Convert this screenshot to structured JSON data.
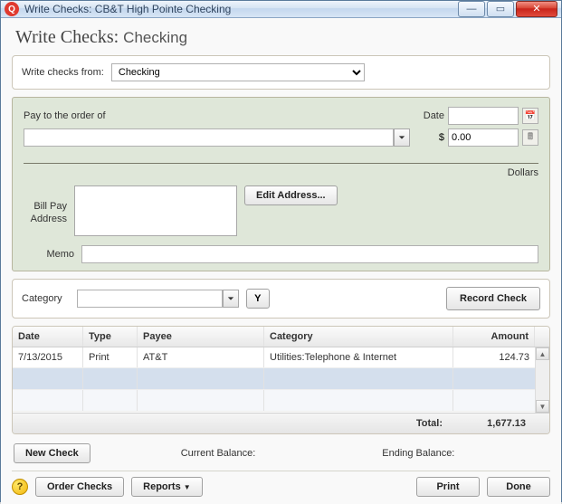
{
  "window": {
    "title": "Write Checks: CB&T High Pointe Checking"
  },
  "page": {
    "title_prefix": "Write Checks:",
    "title_account": "Checking"
  },
  "from": {
    "label": "Write checks from:",
    "value": "Checking"
  },
  "check": {
    "pay_to_label": "Pay to the order of",
    "date_label": "Date",
    "date_value": "",
    "amount_symbol": "$",
    "amount_value": "0.00",
    "dollars_label": "Dollars",
    "edit_address_label": "Edit Address...",
    "bill_pay_label": "Bill Pay\nAddress",
    "memo_label": "Memo",
    "memo_value": "",
    "payee_value": "",
    "address_value": ""
  },
  "category": {
    "label": "Category",
    "value": "",
    "record_label": "Record Check"
  },
  "register": {
    "headers": {
      "date": "Date",
      "type": "Type",
      "payee": "Payee",
      "category": "Category",
      "amount": "Amount"
    },
    "rows": [
      {
        "date": "7/13/2015",
        "type": "Print",
        "payee": "AT&T",
        "category": "Utilities:Telephone & Internet",
        "amount": "124.73"
      }
    ],
    "total_label": "Total:",
    "total_value": "1,677.13"
  },
  "balances": {
    "new_check_label": "New Check",
    "current_label": "Current Balance:",
    "ending_label": "Ending Balance:"
  },
  "footer": {
    "order_checks": "Order Checks",
    "reports": "Reports",
    "print": "Print",
    "done": "Done"
  }
}
